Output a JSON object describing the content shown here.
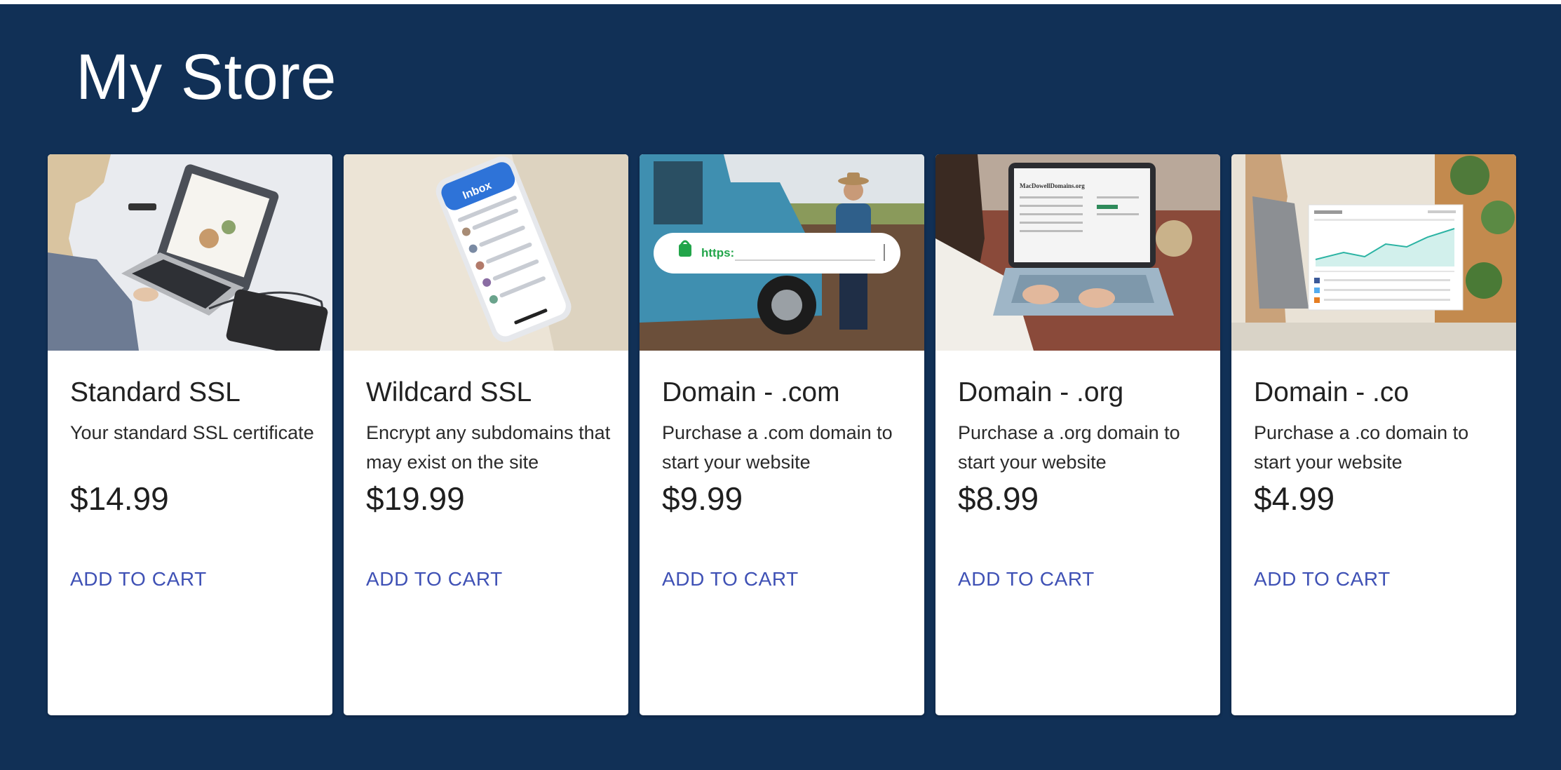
{
  "store": {
    "title": "My Store"
  },
  "products": [
    {
      "name": "Standard SSL",
      "description": "Your standard SSL certificate",
      "price": "$14.99",
      "action_label": "ADD TO CART",
      "image": "laptop-with-drawing-tablet"
    },
    {
      "name": "Wildcard SSL",
      "description": "Encrypt any subdomains that may exist on the site",
      "price": "$19.99",
      "action_label": "ADD TO CART",
      "image": "phone-inbox",
      "image_text": "Inbox"
    },
    {
      "name": "Domain - .com",
      "description": "Purchase a .com domain to start your website",
      "price": "$9.99",
      "action_label": "ADD TO CART",
      "image": "man-with-truck-https-bar",
      "image_text": "https:"
    },
    {
      "name": "Domain - .org",
      "description": "Purchase a .org domain to start your website",
      "price": "$8.99",
      "action_label": "ADD TO CART",
      "image": "woman-typing-laptop",
      "image_text": "MacDowellDomains.org"
    },
    {
      "name": "Domain - .co",
      "description": "Purchase a .co domain to start your website",
      "price": "$4.99",
      "action_label": "ADD TO CART",
      "image": "woman-with-dashboard-overlay"
    }
  ],
  "colors": {
    "background": "#113056",
    "card": "#ffffff",
    "action": "#3f51b5",
    "text": "#212121"
  }
}
